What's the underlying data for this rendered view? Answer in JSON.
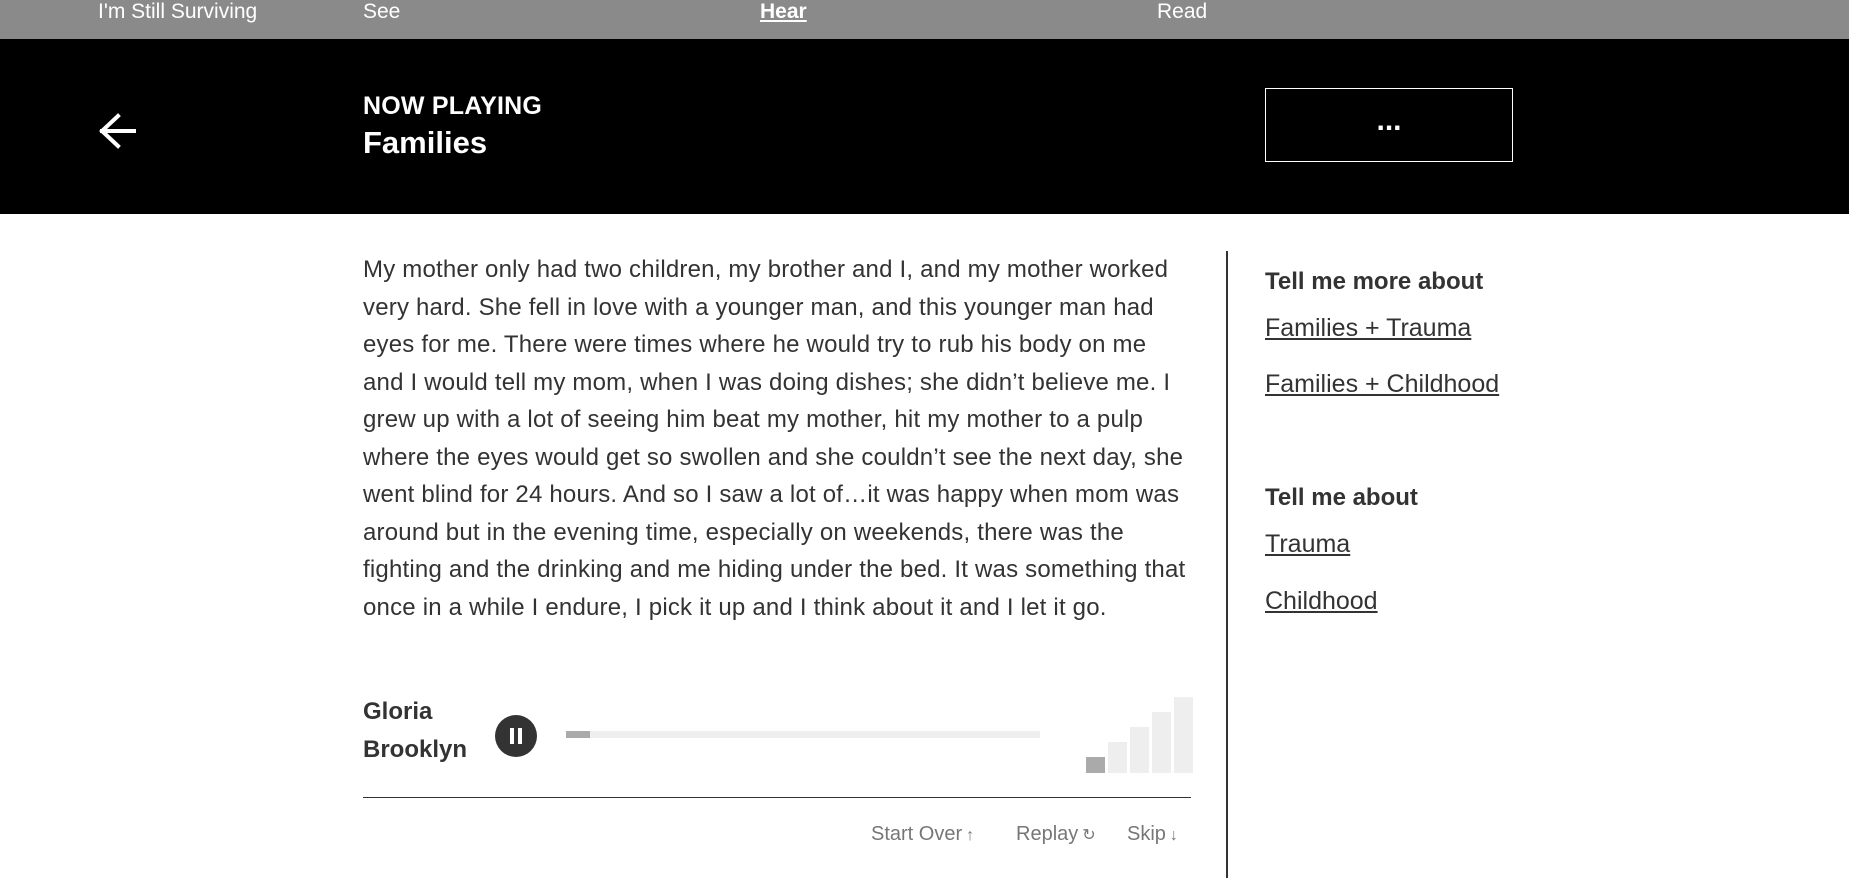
{
  "nav": {
    "items": [
      {
        "label": "I'm Still Surviving",
        "active": false
      },
      {
        "label": "See",
        "active": false
      },
      {
        "label": "Hear",
        "active": true
      },
      {
        "label": "Read",
        "active": false
      }
    ]
  },
  "header": {
    "back_icon": "arrow-left-icon",
    "kicker": "NOW PLAYING",
    "title": "Families",
    "more_label": "..."
  },
  "transcript": "My mother only had two children, my brother and I, and my mother worked very hard. She fell in love with a younger man, and this younger man had eyes for me. There were times where he would try to rub his body on me and I would tell my mom, when I was doing dishes; she didn’t believe me. I grew up with a lot of seeing him beat my mother, hit my mother to a pulp where the eyes would get so swollen and she couldn’t see the next day, she went blind for 24 hours. And so I saw a lot of…it was happy when mom was around but in the evening time, especially on weekends, there was the fighting and the drinking and me hiding under the bed. It was something that once in a while I endure, I pick it up and I think about it and I let it go.",
  "player": {
    "speaker": "Gloria",
    "location": "Brooklyn",
    "state_icon": "pause-icon",
    "progress": 0.05,
    "volume_level": 1,
    "volume_levels": 5
  },
  "controls": {
    "start_over": {
      "label": "Start Over",
      "glyph": "↑"
    },
    "replay": {
      "label": "Replay",
      "glyph": "↻"
    },
    "skip": {
      "label": "Skip",
      "glyph": "↓"
    }
  },
  "sidebar": {
    "more_heading": "Tell me more about",
    "more_links": [
      "Families + Trauma",
      "Families + Childhood"
    ],
    "about_heading": "Tell me about",
    "about_links": [
      "Trauma",
      "Childhood"
    ]
  },
  "colors": {
    "nav_bg": "#8a8a8a",
    "header_bg": "#000000",
    "text": "#333333",
    "muted": "#777777"
  }
}
